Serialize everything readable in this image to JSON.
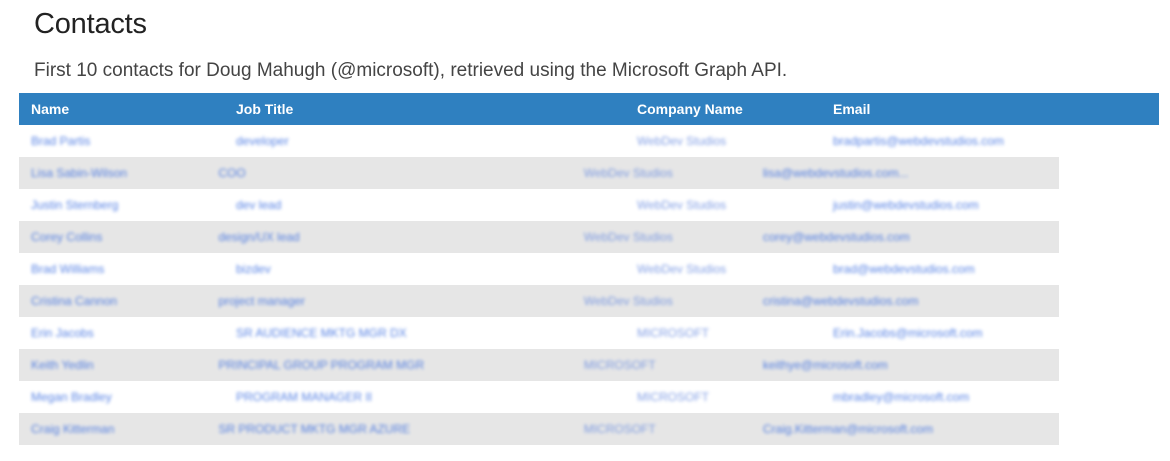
{
  "page": {
    "title": "Contacts",
    "subtitle": "First 10 contacts for Doug Mahugh (@microsoft), retrieved using the Microsoft Graph API."
  },
  "table": {
    "columns": [
      "Name",
      "Job Title",
      "Company Name",
      "Email"
    ],
    "rows": [
      {
        "name": "Brad Partis",
        "job": "developer",
        "company": "WebDev Studios",
        "email": "bradpartis@webdevstudios.com"
      },
      {
        "name": "Lisa Sabin-Wilson",
        "job": "COO",
        "company": "WebDev Studios",
        "email": "lisa@webdevstudios.com..."
      },
      {
        "name": "Justin Sternberg",
        "job": "dev lead",
        "company": "WebDev Studios",
        "email": "justin@webdevstudios.com"
      },
      {
        "name": "Corey Collins",
        "job": "design/UX lead",
        "company": "WebDev Studios",
        "email": "corey@webdevstudios.com"
      },
      {
        "name": "Brad Williams",
        "job": "bizdev",
        "company": "WebDev Studios",
        "email": "brad@webdevstudios.com"
      },
      {
        "name": "Cristina Cannon",
        "job": "project manager",
        "company": "WebDev Studios",
        "email": "cristina@webdevstudios.com"
      },
      {
        "name": "Erin Jacobs",
        "job": "SR AUDIENCE MKTG MGR DX",
        "company": "MICROSOFT",
        "email": "Erin.Jacobs@microsoft.com"
      },
      {
        "name": "Keith Yedlin",
        "job": "PRINCIPAL GROUP PROGRAM MGR",
        "company": "MICROSOFT",
        "email": "keithye@microsoft.com"
      },
      {
        "name": "Megan Bradley",
        "job": "PROGRAM MANAGER II",
        "company": "MICROSOFT",
        "email": "mbradley@microsoft.com"
      },
      {
        "name": "Craig Kitterman",
        "job": "SR PRODUCT MKTG MGR AZURE",
        "company": "MICROSOFT",
        "email": "Craig.Kitterman@microsoft.com"
      }
    ]
  },
  "colors": {
    "header_bg": "#2f80c0",
    "row_alt_bg": "#e6e6e6",
    "link": "#3d6fe0"
  }
}
